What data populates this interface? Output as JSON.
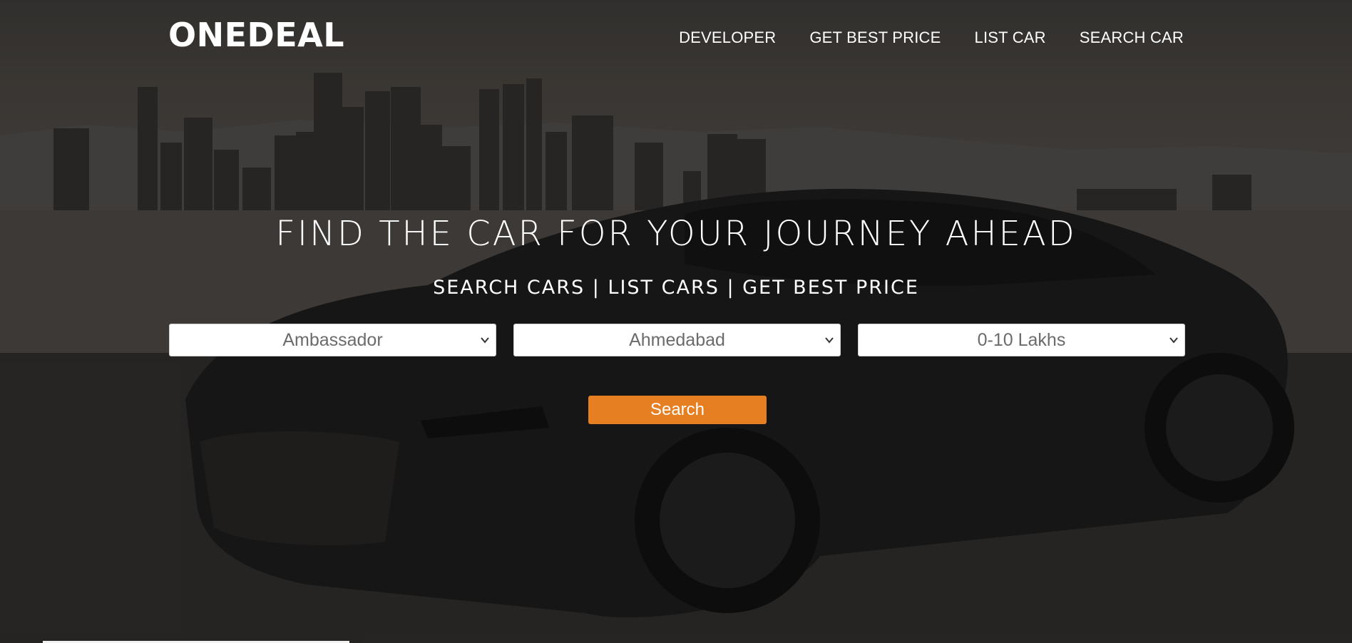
{
  "brand": {
    "name": "ONEDEAL"
  },
  "nav": {
    "items": [
      {
        "label": "DEVELOPER"
      },
      {
        "label": "GET BEST PRICE"
      },
      {
        "label": "LIST CAR"
      },
      {
        "label": "SEARCH CAR"
      }
    ]
  },
  "hero": {
    "headline": "FIND THE CAR FOR YOUR JOURNEY AHEAD",
    "subline": "SEARCH CARS | LIST CARS | GET BEST PRICE"
  },
  "filters": {
    "brand_selected": "Ambassador",
    "city_selected": "Ahmedabad",
    "budget_selected": "0-10 Lakhs"
  },
  "search": {
    "label": "Search"
  },
  "colors": {
    "accent": "#e67e22",
    "text": "#ffffff",
    "select_text": "#6b6b6b"
  },
  "icons": {
    "select_arrow": "chevron-down-icon"
  }
}
